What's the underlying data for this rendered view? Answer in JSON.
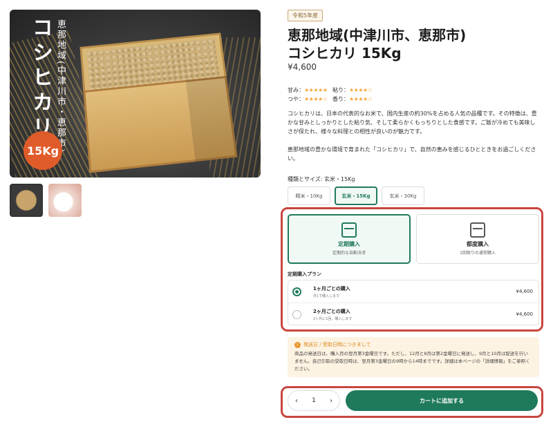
{
  "gallery": {
    "photo_title": "コシヒカリ",
    "photo_sub": "恵那地域(中津川市・恵那市)",
    "weight_badge": "15Kg"
  },
  "product": {
    "era_badge": "令和5年産",
    "title_line1": "恵那地域(中津川市、恵那市)",
    "title_line2": "コシヒカリ 15Kg",
    "price": "¥4,600"
  },
  "ratings": {
    "sweetness_label": "甘み：",
    "sweetness_stars": "★★★★★",
    "stickiness_label": "粘り：",
    "stickiness_stars": "★★★★☆",
    "gloss_label": "つや：",
    "gloss_stars": "★★★★☆",
    "aroma_label": "香り：",
    "aroma_stars": "★★★★☆"
  },
  "description": {
    "para1": "コシヒカリは、日本の代表的なお米で、国内生産の約30%を占める人気の品種です。その特徴は、豊かな甘みとしっかりとした粘り気、そして柔らかくもっちりとした食感です。ご飯が冷めても美味しさが保たれ、様々な料理との相性が良いのが魅力です。",
    "para2": "恵那地域の豊かな環境で育まれた「コシヒカリ」で、自然の恵みを感じるひとときをお過ごしください。"
  },
  "variant": {
    "label": "種類とサイズ: 玄米・15Kg",
    "options": [
      "精米・10Kg",
      "玄米・15Kg",
      "玄米・30Kg"
    ],
    "selected_index": 1
  },
  "purchase_type": {
    "subscription_label": "定期購入",
    "subscription_sub": "定期的な自動決済",
    "one_time_label": "都度購入",
    "one_time_sub": "1回限りの通常購入"
  },
  "plan": {
    "title": "定期購入プラン",
    "rows": [
      {
        "name": "1ヶ月ごとの購入",
        "note": "月1で購入します",
        "price": "¥4,600"
      },
      {
        "name": "2ヶ月ごとの購入",
        "note": "2ヶ月に1回、購入します",
        "price": "¥4,600"
      }
    ]
  },
  "notice": {
    "head": "発送日 / 受取日時につきまして",
    "body": "商品の発送日は、購入月の翌月第3金曜日です。ただし、12月と8月は第2金曜日に発送し、9月と10月は配送を行いません。自己引取の受取日時は、翌月第3金曜日の9時から14時までです。詳細は本ページの「詳細情報」をご参照ください。"
  },
  "cart": {
    "quantity": "1",
    "decrement": "‹",
    "increment": "›",
    "add_label": "カートに追加する"
  },
  "colors": {
    "accent": "#1f7a5c",
    "highlight_border": "#c8453f",
    "star": "#f3a43b",
    "notice_bg": "#fdf3e2"
  }
}
